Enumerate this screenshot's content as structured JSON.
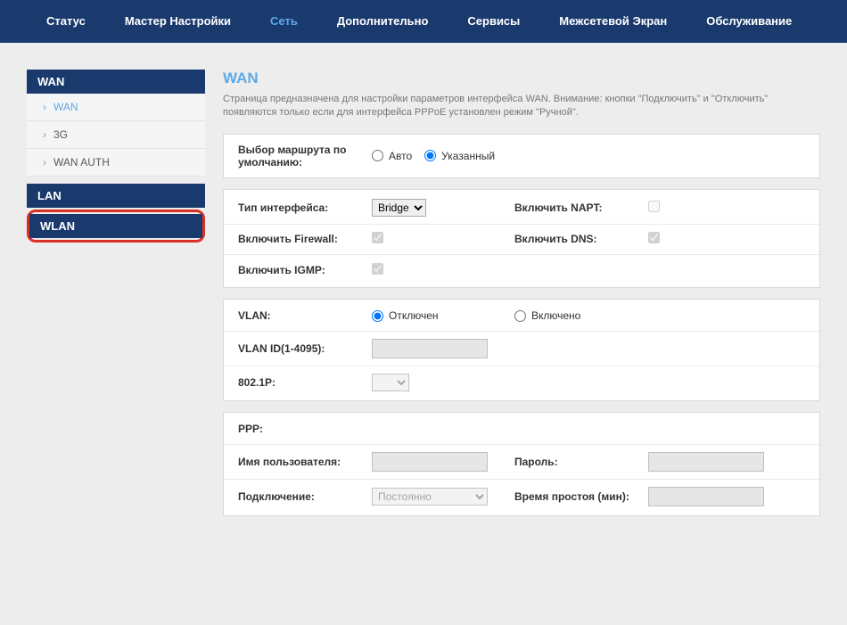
{
  "nav": {
    "items": [
      {
        "label": "Статус"
      },
      {
        "label": "Мастер Настройки"
      },
      {
        "label": "Сеть"
      },
      {
        "label": "Дополнительно"
      },
      {
        "label": "Сервисы"
      },
      {
        "label": "Межсетевой Экран"
      },
      {
        "label": "Обслуживание"
      }
    ]
  },
  "sidebar": {
    "wan_header": "WAN",
    "wan_items": [
      {
        "label": "WAN"
      },
      {
        "label": "3G"
      },
      {
        "label": "WAN AUTH"
      }
    ],
    "lan_header": "LAN",
    "wlan_header": "WLAN"
  },
  "page": {
    "title": "WAN",
    "description": "Страница предназначена для настройки параметров интерфейса WAN. Внимание: кнопки \"Подключить\" и \"Отключить\" появляются только если для интерфейса PPPoE установлен режим \"Ручной\"."
  },
  "panel1": {
    "route_label": "Выбор маршрута по умолчанию:",
    "route_auto": "Авто",
    "route_specified": "Указанный"
  },
  "panel2": {
    "iface_type_label": "Тип интерфейса:",
    "iface_type_value": "Bridge",
    "napt_label": "Включить NAPT:",
    "firewall_label": "Включить Firewall:",
    "dns_label": "Включить DNS:",
    "igmp_label": "Включить IGMP:"
  },
  "panel3": {
    "vlan_label": "VLAN:",
    "vlan_off": "Отключен",
    "vlan_on": "Включено",
    "vlan_id_label": "VLAN ID(1-4095):",
    "vlan_id_value": "",
    "p8021_label": "802.1P:",
    "p8021_value": ""
  },
  "panel4": {
    "ppp_label": "PPP:",
    "user_label": "Имя пользователя:",
    "user_value": "",
    "pass_label": "Пароль:",
    "pass_value": "",
    "conn_label": "Подключение:",
    "conn_value": "Постоянно",
    "idle_label": "Время простоя (мин):",
    "idle_value": ""
  }
}
